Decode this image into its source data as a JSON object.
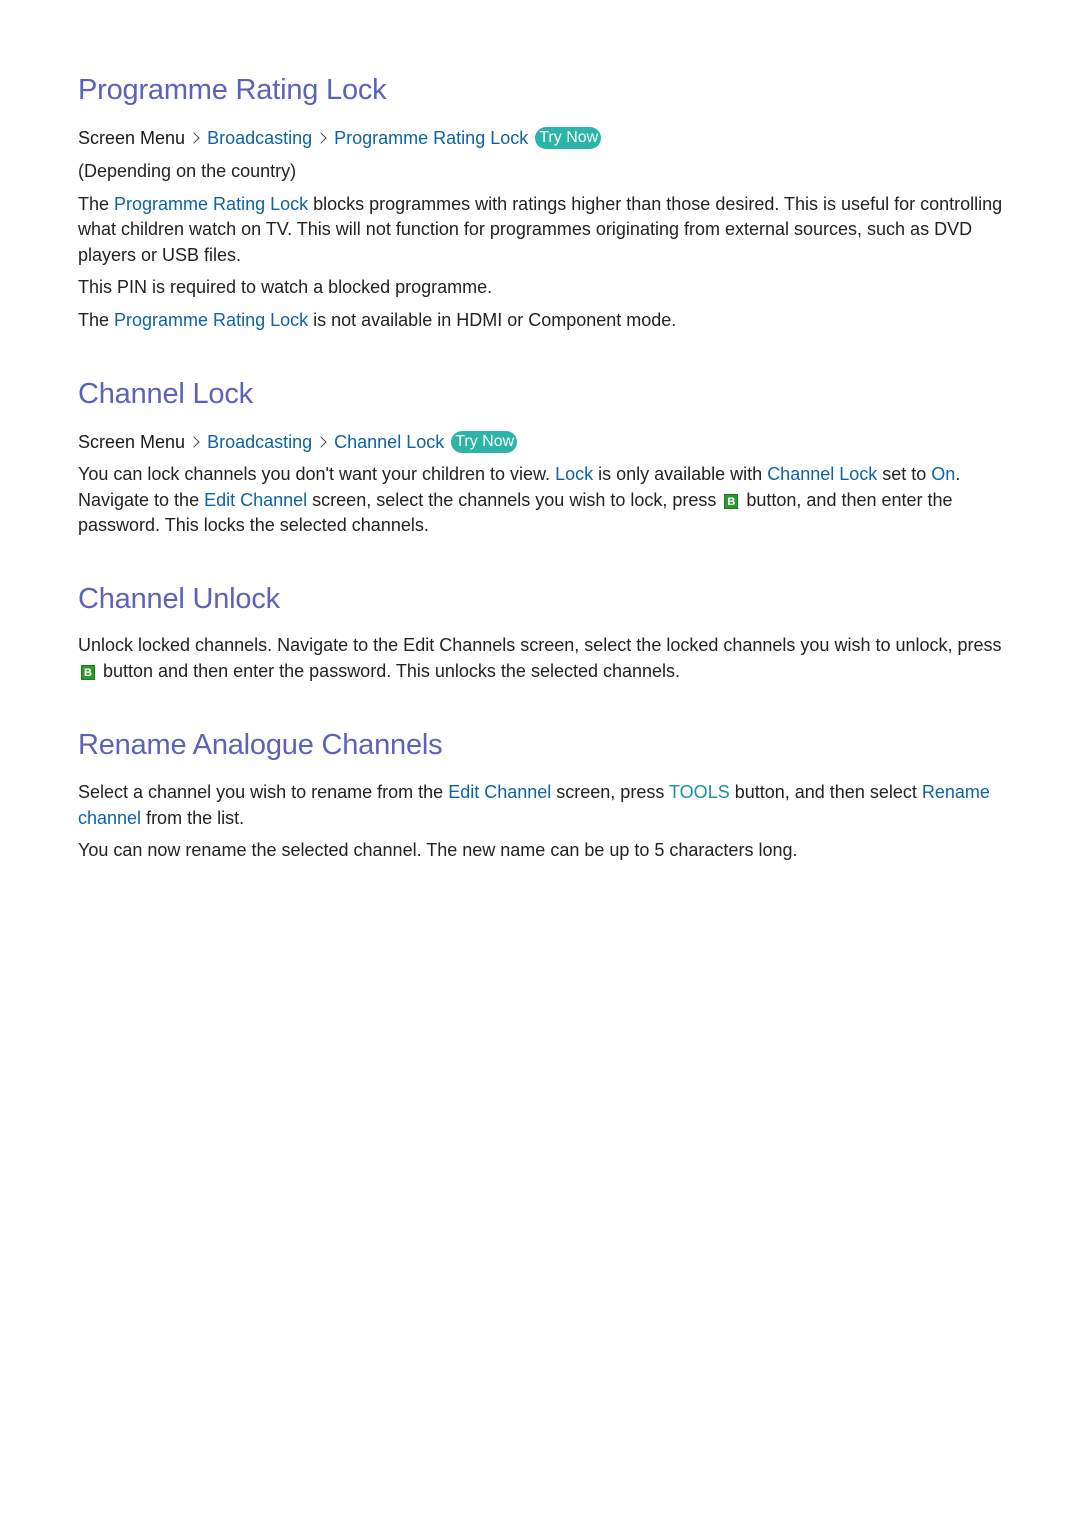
{
  "colors": {
    "heading": "#5a63b8",
    "link": "#0d62a8",
    "teal_keyword": "#1690a5",
    "try_now_bg": "#2bb5a8",
    "b_button": "#2a9b2a",
    "body_text": "#222222"
  },
  "sections": [
    {
      "title": "Programme Rating Lock",
      "path": {
        "root": "Screen Menu",
        "items": [
          "Broadcasting",
          "Programme Rating Lock"
        ],
        "try_now": "Try Now",
        "separator_icon": "chevron-right-icon"
      },
      "note": "(Depending on the country)",
      "p1": {
        "t0": "The ",
        "k0": "Programme Rating Lock",
        "t1": " blocks programmes with ratings higher than those desired. This is useful for controlling what children watch on TV. This will not function for programmes originating from external sources, such as DVD players or USB files."
      },
      "p2": "This PIN is required to watch a blocked programme.",
      "p3": {
        "t0": "The ",
        "k0": "Programme Rating Lock",
        "t1": " is not available in HDMI or Component mode."
      }
    },
    {
      "title": "Channel Lock",
      "path": {
        "root": "Screen Menu",
        "items": [
          "Broadcasting",
          "Channel Lock"
        ],
        "try_now": "Try Now",
        "separator_icon": "chevron-right-icon"
      },
      "p1": {
        "t0": "You can lock channels you don't want your children to view. ",
        "k0": "Lock",
        "t1": " is only available with ",
        "k1": "Channel Lock",
        "t2": " set to ",
        "k2": "On",
        "t3": ". Navigate to the ",
        "k3": "Edit Channel",
        "t4": " screen, select the channels you wish to lock, press ",
        "btn": "B",
        "t5": " button, and then enter the password. This locks the selected channels."
      }
    },
    {
      "title": "Channel Unlock",
      "p1": {
        "t0": "Unlock locked channels. Navigate to the Edit Channels screen, select the locked channels you wish to unlock, press ",
        "btn": "B",
        "t1": " button and then enter the password. This unlocks the selected channels."
      }
    },
    {
      "title": "Rename Analogue Channels",
      "p1": {
        "t0": "Select a channel you wish to rename from the ",
        "k0": "Edit Channel",
        "t1": " screen, press ",
        "k1": "TOOLS",
        "t2": " button, and then select ",
        "k2": "Rename channel",
        "t3": " from the list."
      },
      "p2": "You can now rename the selected channel. The new name can be up to 5 characters long."
    }
  ]
}
